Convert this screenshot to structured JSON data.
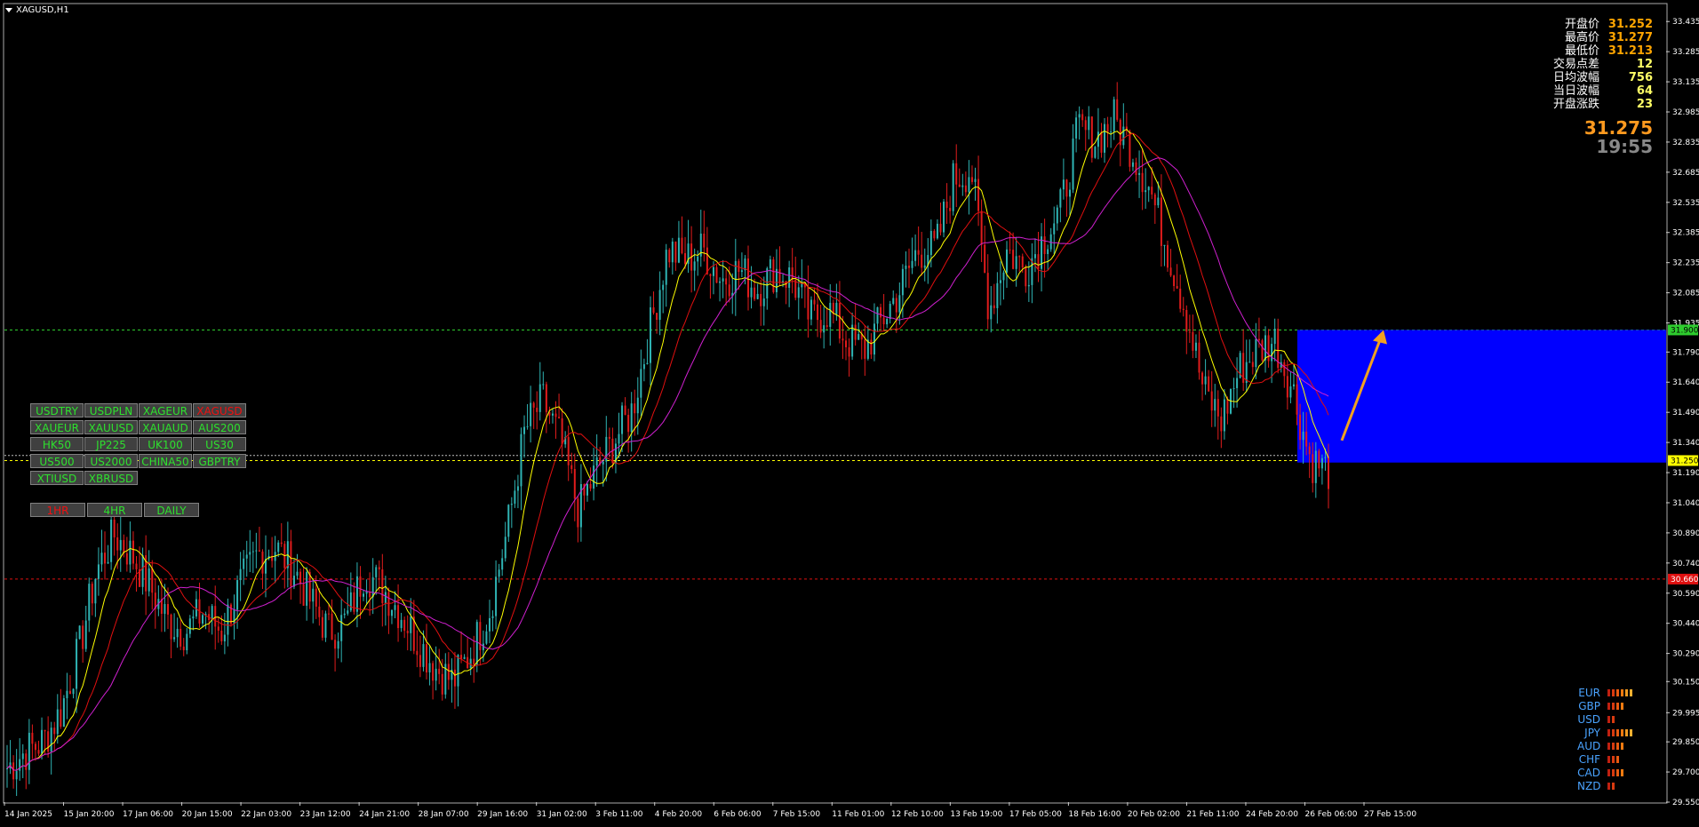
{
  "window": {
    "title": "XAGUSD,H1"
  },
  "info_panel": [
    {
      "label": "开盘价",
      "value": "31.252",
      "color": "#ffa500"
    },
    {
      "label": "最高价",
      "value": "31.277",
      "color": "#ffa500"
    },
    {
      "label": "最低价",
      "value": "31.213",
      "color": "#ffa500"
    },
    {
      "label": "交易点差",
      "value": "12",
      "color": "#ffff66"
    },
    {
      "label": "日均波幅",
      "value": "756",
      "color": "#ffff66"
    },
    {
      "label": "当日波幅",
      "value": "64",
      "color": "#ffff66"
    },
    {
      "label": "开盘涨跌",
      "value": "23",
      "color": "#ffff66"
    }
  ],
  "current_price": "31.275",
  "countdown": "19:55",
  "symbol_buttons": [
    [
      "USDTRY",
      "USDPLN",
      "XAGEUR",
      "XAGUSD"
    ],
    [
      "XAUEUR",
      "XAUUSD",
      "XAUAUD",
      "AUS200"
    ],
    [
      "HK50",
      "JP225",
      "UK100",
      "US30"
    ],
    [
      "US500",
      "US2000",
      "CHINA50",
      "GBPTRY"
    ],
    [
      "XTIUSD",
      "XBRUSD"
    ]
  ],
  "active_symbol": "XAGUSD",
  "timeframe_buttons": [
    "1HR",
    "4HR",
    "DAILY"
  ],
  "active_timeframe": "1HR",
  "currency_strength": [
    {
      "currency": "EUR",
      "level": 6
    },
    {
      "currency": "GBP",
      "level": 4
    },
    {
      "currency": "USD",
      "level": 2
    },
    {
      "currency": "JPY",
      "level": 6
    },
    {
      "currency": "AUD",
      "level": 4
    },
    {
      "currency": "CHF",
      "level": 3
    },
    {
      "currency": "CAD",
      "level": 4
    },
    {
      "currency": "NZD",
      "level": 2
    }
  ],
  "chart_data": {
    "type": "candlestick",
    "symbol": "XAGUSD",
    "timeframe": "H1",
    "ylim": [
      29.55,
      33.52
    ],
    "y_ticks": [
      "33.435",
      "33.285",
      "33.135",
      "32.985",
      "32.835",
      "32.685",
      "32.535",
      "32.385",
      "32.235",
      "32.085",
      "31.935",
      "31.790",
      "31.640",
      "31.490",
      "31.340",
      "31.190",
      "31.040",
      "30.890",
      "30.740",
      "30.590",
      "30.440",
      "30.290",
      "30.150",
      "29.995",
      "29.850",
      "29.700",
      "29.550"
    ],
    "x_labels": [
      "14 Jan 2025",
      "15 Jan 20:00",
      "17 Jan 06:00",
      "20 Jan 15:00",
      "22 Jan 03:00",
      "23 Jan 12:00",
      "24 Jan 21:00",
      "28 Jan 07:00",
      "29 Jan 16:00",
      "31 Jan 02:00",
      "3 Feb 11:00",
      "4 Feb 20:00",
      "6 Feb 06:00",
      "7 Feb 15:00",
      "11 Feb 01:00",
      "12 Feb 10:00",
      "13 Feb 19:00",
      "17 Feb 05:00",
      "18 Feb 16:00",
      "20 Feb 02:00",
      "21 Feb 11:00",
      "24 Feb 20:00",
      "26 Feb 06:00",
      "27 Feb 15:00"
    ],
    "horizontal_lines": [
      {
        "price": 31.9,
        "label": "31.900",
        "color": "#2ecc2e"
      },
      {
        "price": 31.25,
        "label": "31.250",
        "color": "#ffff00"
      },
      {
        "price": 30.66,
        "label": "30.660",
        "color": "#e01010"
      }
    ],
    "current_line": {
      "price": 31.275
    },
    "zone": {
      "top": 31.9,
      "bottom": 31.24,
      "color": "#0000ff"
    },
    "close_path": [
      29.72,
      29.8,
      29.85,
      30.0,
      30.3,
      30.7,
      30.88,
      30.78,
      30.62,
      30.45,
      30.4,
      30.5,
      30.4,
      30.62,
      30.78,
      30.82,
      30.72,
      30.55,
      30.4,
      30.45,
      30.7,
      30.62,
      30.5,
      30.35,
      30.22,
      30.15,
      30.3,
      30.5,
      30.9,
      31.4,
      31.55,
      31.35,
      31.0,
      31.2,
      31.35,
      31.5,
      31.9,
      32.3,
      32.25,
      32.3,
      32.15,
      32.2,
      32.1,
      32.2,
      32.15,
      31.95,
      32.0,
      31.85,
      31.8,
      31.95,
      32.1,
      32.3,
      32.3,
      32.65,
      32.7,
      32.0,
      32.3,
      32.2,
      32.35,
      32.5,
      32.9,
      32.85,
      32.95,
      32.8,
      32.6,
      32.3,
      32.0,
      31.6,
      31.45,
      31.7,
      31.8,
      31.85,
      31.6,
      31.25,
      31.2
    ]
  }
}
